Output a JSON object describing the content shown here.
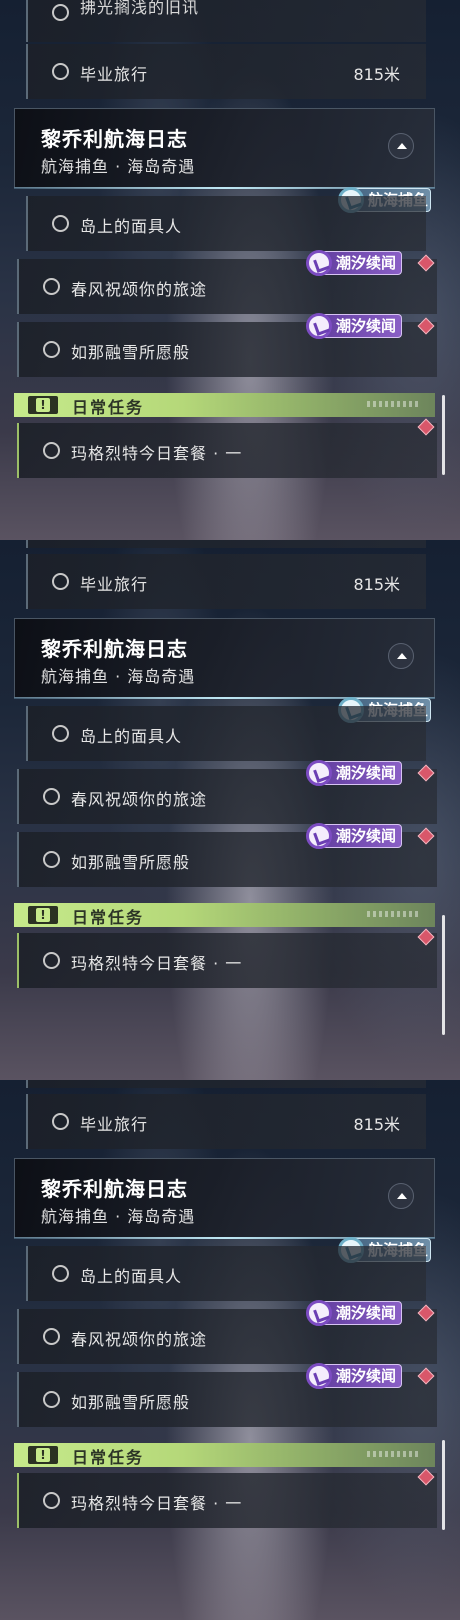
{
  "panels": [
    {
      "partial_item": "拂光搁浅的旧讯",
      "travel": {
        "label": "毕业旅行",
        "distance": "815米"
      },
      "quest_group": {
        "title": "黎乔利航海日志",
        "subtitle": "航海捕鱼 · 海岛奇遇"
      },
      "fish_tag": "航海捕鱼",
      "items": [
        {
          "label": "岛上的面具人"
        },
        {
          "label": "春风祝颂你的旅途",
          "tag": "潮汐续闻"
        },
        {
          "label": "如那融雪所愿般",
          "tag": "潮汐续闻"
        }
      ],
      "daily": {
        "header": "日常任务",
        "icon": "!",
        "item": "玛格烈特今日套餐 · 一"
      }
    },
    {
      "partial_item": "",
      "travel": {
        "label": "毕业旅行",
        "distance": "815米"
      },
      "quest_group": {
        "title": "黎乔利航海日志",
        "subtitle": "航海捕鱼 · 海岛奇遇"
      },
      "fish_tag": "航海捕鱼",
      "items": [
        {
          "label": "岛上的面具人"
        },
        {
          "label": "春风祝颂你的旅途",
          "tag": "潮汐续闻"
        },
        {
          "label": "如那融雪所愿般",
          "tag": "潮汐续闻"
        }
      ],
      "daily": {
        "header": "日常任务",
        "icon": "!",
        "item": "玛格烈特今日套餐 · 一"
      }
    },
    {
      "partial_item": "",
      "travel": {
        "label": "毕业旅行",
        "distance": "815米"
      },
      "quest_group": {
        "title": "黎乔利航海日志",
        "subtitle": "航海捕鱼 · 海岛奇遇"
      },
      "fish_tag": "航海捕鱼",
      "items": [
        {
          "label": "岛上的面具人"
        },
        {
          "label": "春风祝颂你的旅途",
          "tag": "潮汐续闻"
        },
        {
          "label": "如那融雪所愿般",
          "tag": "潮汐续闻"
        }
      ],
      "daily": {
        "header": "日常任务",
        "icon": "!",
        "item": "玛格烈特今日套餐 · 一"
      }
    }
  ],
  "colors": {
    "daily_accent": "#c6ea8b",
    "tide_tag": "#7c4cc2",
    "fish_tag": "#6fb0c8",
    "marker": "#d9576a"
  }
}
